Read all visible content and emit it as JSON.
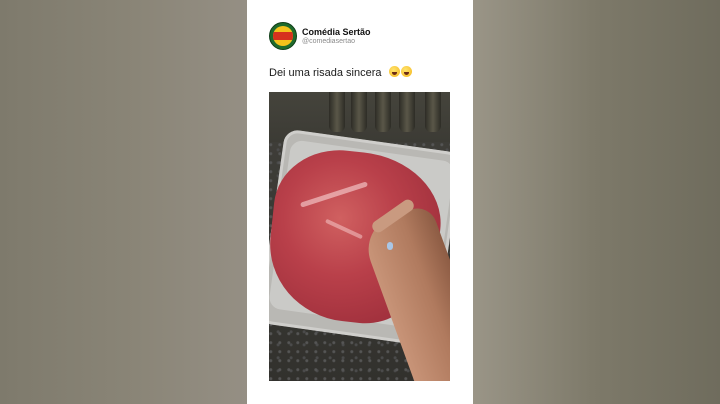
{
  "post": {
    "author_name": "Comédia Sertão",
    "author_handle": "@comediasertao",
    "avatar_text": "COMÉDIA SERTÃO",
    "caption": "Dei uma risada sincera",
    "caption_emojis": [
      "laughing-tears-emoji",
      "laughing-tears-emoji"
    ]
  },
  "media": {
    "description_icon": "video-frame"
  },
  "colors": {
    "card_background": "#ffffff",
    "side_background": "#7b7868",
    "avatar_ring": "#1f6b2c",
    "avatar_fill": "#f4c21b",
    "avatar_band": "#d6321e"
  }
}
